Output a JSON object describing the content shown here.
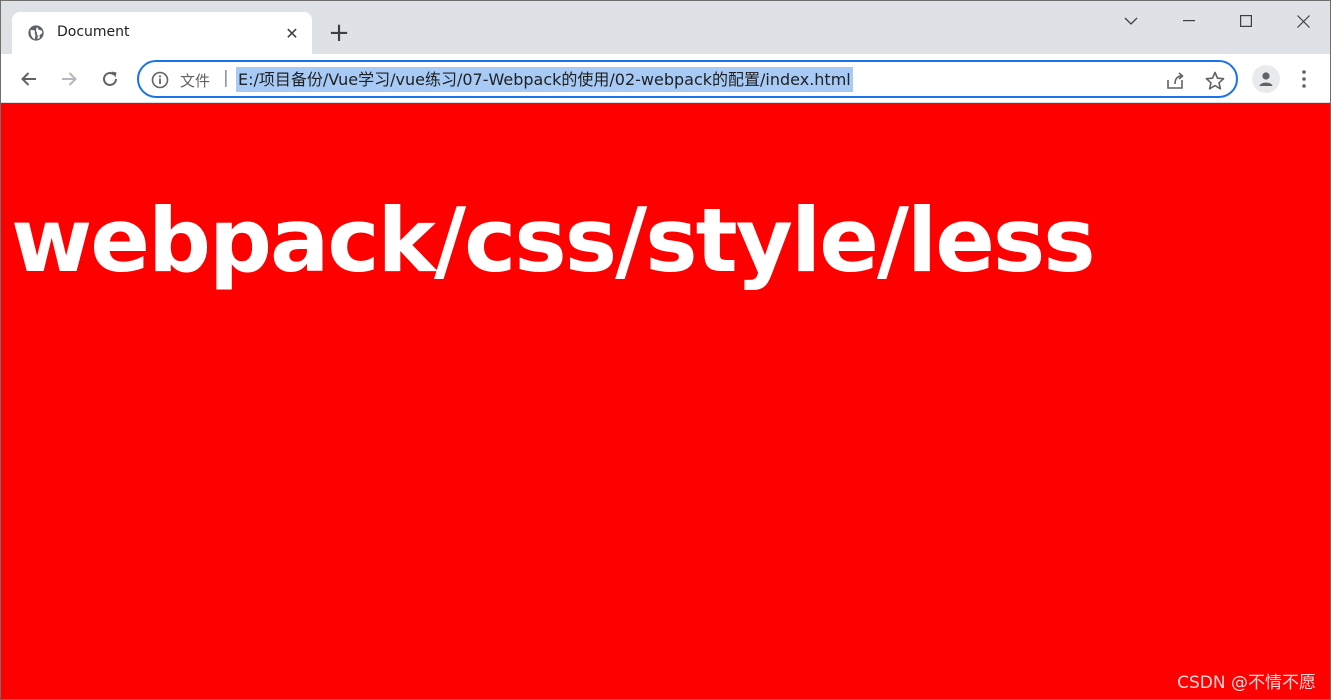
{
  "browser": {
    "tab": {
      "title": "Document",
      "close_glyph": "✕",
      "icon": "globe-icon"
    },
    "new_tab_glyph": "+",
    "window_controls": [
      "chevron-down-icon",
      "minimize-icon",
      "maximize-icon",
      "close-icon"
    ],
    "omnibox": {
      "scheme_label": "文件",
      "separator": "|",
      "url": "E:/项目备份/Vue学习/vue练习/07-Webpack的使用/02-webpack的配置/index.html"
    },
    "accent_color": "#1a73e8",
    "selection_color": "#a8cbf5"
  },
  "page": {
    "background_color": "#ff0000",
    "heading": "webpack/css/style/less",
    "watermark": "CSDN @不情不愿"
  }
}
